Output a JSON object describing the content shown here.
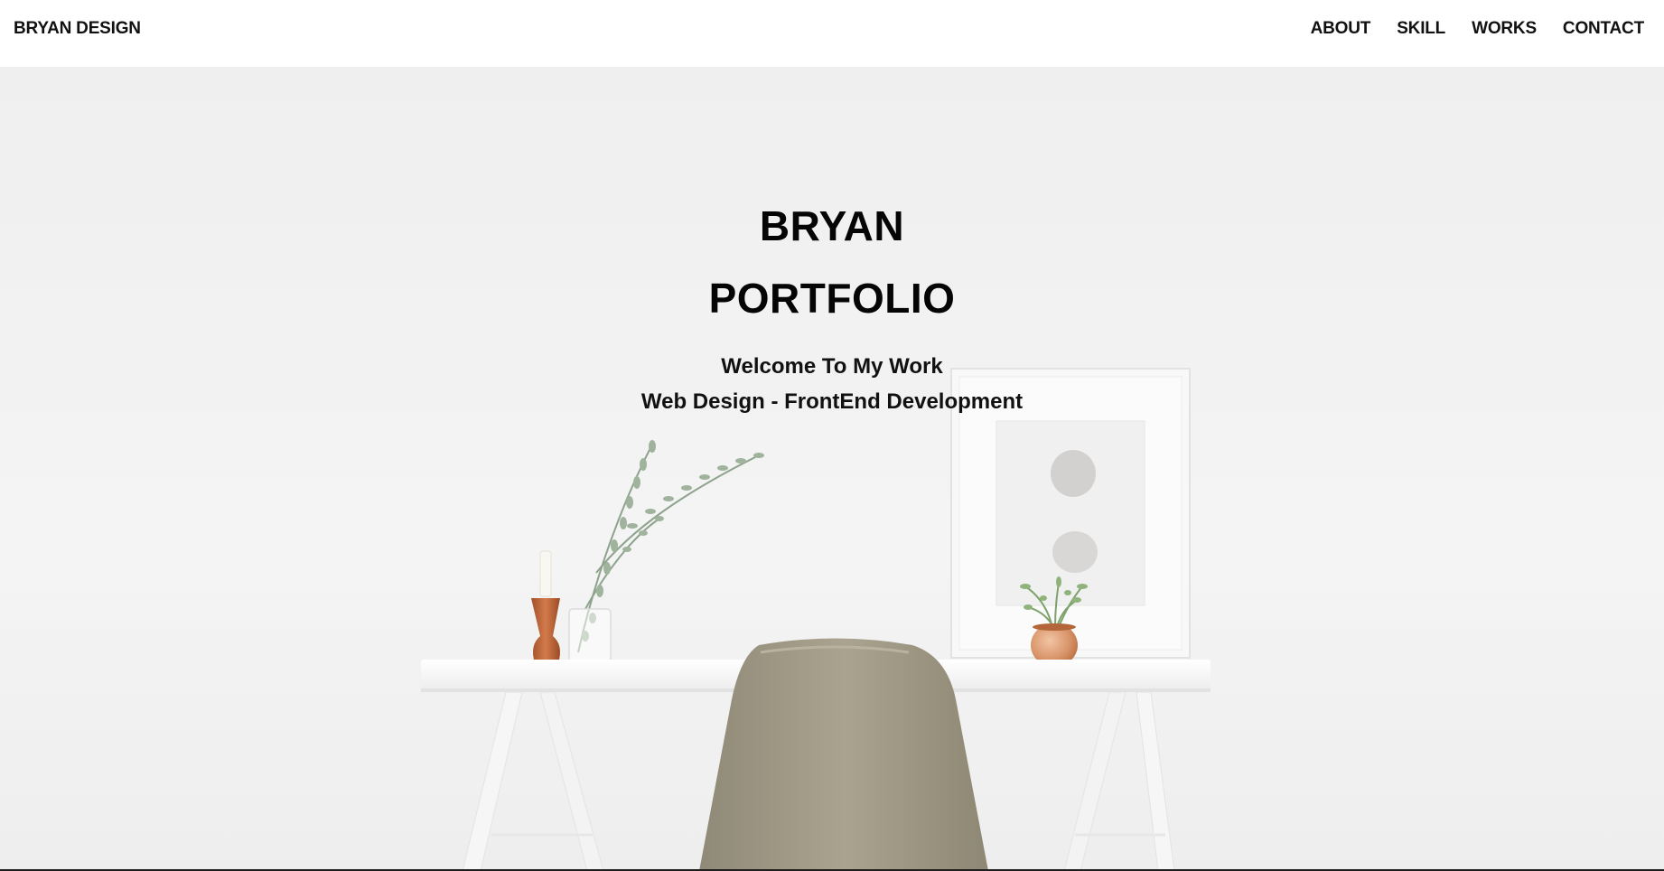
{
  "header": {
    "brand": "BRYAN DESIGN",
    "nav": [
      {
        "label": "ABOUT"
      },
      {
        "label": "SKILL"
      },
      {
        "label": "WORKS"
      },
      {
        "label": "CONTACT"
      }
    ]
  },
  "hero": {
    "title_line1": "BRYAN",
    "title_line2": "PORTFOLIO",
    "subtitle_line1": "Welcome To My Work",
    "subtitle_line2": "Web Design - FrontEnd Development",
    "background_image": "desk-scene-image"
  },
  "colors": {
    "text": "#0d0d0d",
    "header_bg": "#ffffff",
    "wall": "#f2f2f2",
    "chair": "#a8a18d",
    "copper": "#c8764a"
  }
}
